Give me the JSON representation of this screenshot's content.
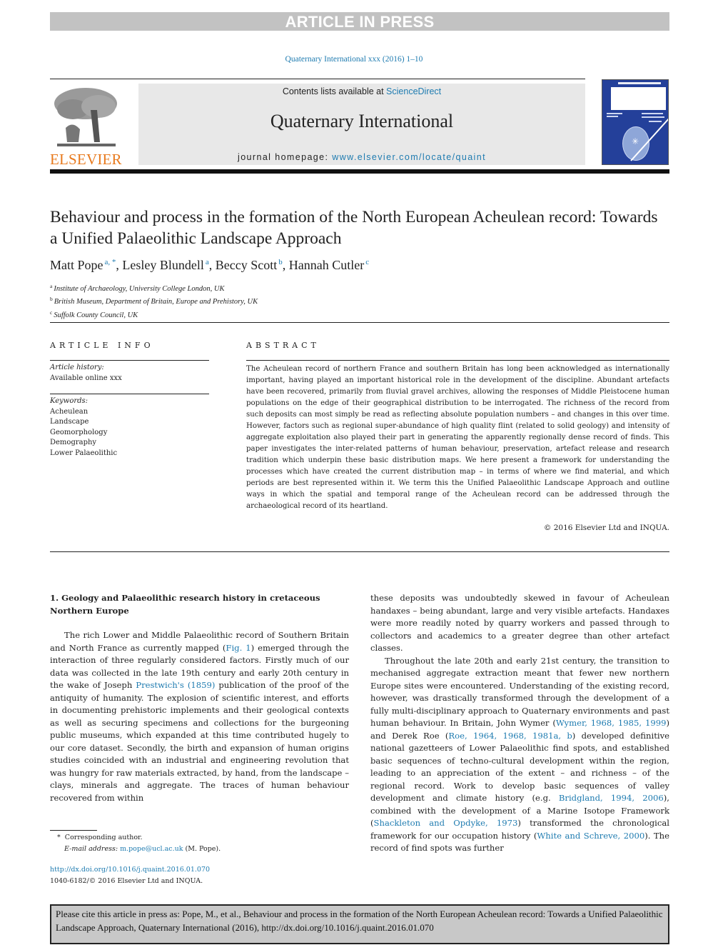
{
  "banner": "ARTICLE IN PRESS",
  "journal_ref": "Quaternary International xxx (2016) 1–10",
  "header": {
    "contents_prefix": "Contents lists available at ",
    "contents_link": "ScienceDirect",
    "journal_name": "Quaternary International",
    "homepage_prefix": "journal homepage: ",
    "homepage_link": "www.elsevier.com/locate/quaint",
    "publisher_logo": "ELSEVIER"
  },
  "article": {
    "title": "Behaviour and process in the formation of the North European Acheulean record: Towards a Unified Palaeolithic Landscape Approach",
    "authors": [
      {
        "name": "Matt Pope",
        "sup": "a, *",
        "sep": ", "
      },
      {
        "name": "Lesley Blundell",
        "sup": "a",
        "sep": ", "
      },
      {
        "name": "Beccy Scott",
        "sup": "b",
        "sep": ", "
      },
      {
        "name": "Hannah Cutler",
        "sup": "c",
        "sep": ""
      }
    ],
    "affiliations": [
      {
        "mark": "a",
        "text": "Institute of Archaeology, University College London, UK"
      },
      {
        "mark": "b",
        "text": "British Museum, Department of Britain, Europe and Prehistory, UK"
      },
      {
        "mark": "c",
        "text": "Suffolk County Council, UK"
      }
    ]
  },
  "article_info": {
    "heading": "ARTICLE INFO",
    "history_label": "Article history:",
    "history_value": "Available online xxx",
    "keywords_label": "Keywords:",
    "keywords": [
      "Acheulean",
      "Landscape",
      "Geomorphology",
      "Demography",
      "Lower Palaeolithic"
    ]
  },
  "abstract": {
    "heading": "ABSTRACT",
    "text": "The Acheulean record of northern France and southern Britain has long been acknowledged as internationally important, having played an important historical role in the development of the discipline. Abundant artefacts have been recovered, primarily from fluvial gravel archives, allowing the responses of Middle Pleistocene human populations on the edge of their geographical distribution to be interrogated. The richness of the record from such deposits can most simply be read as reflecting absolute population numbers – and changes in this over time. However, factors such as regional super-abundance of high quality flint (related to solid geology) and intensity of aggregate exploitation also played their part in generating the apparently regionally dense record of finds. This paper investigates the inter-related patterns of human behaviour, preservation, artefact release and research tradition which underpin these basic distribution maps. We here present a framework for understanding the processes which have created the current distribution map – in terms of where we find material, and which periods are best represented within it. We term this the Unified Palaeolithic Landscape Approach and outline ways in which the spatial and temporal range of the Acheulean record can be addressed through the archaeological record of its heartland.",
    "copyright": "© 2016 Elsevier Ltd and INQUA."
  },
  "body": {
    "section_heading": "1.  Geology and Palaeolithic research history in cretaceous Northern Europe",
    "p1": {
      "t1": "The rich Lower and Middle Palaeolithic record of Southern Britain and North France as currently mapped (",
      "l1": "Fig. 1",
      "t2": ") emerged through the interaction of three regularly considered factors. Firstly much of our data was collected in the late 19th century and early 20th century in the wake of Joseph ",
      "l2": "Prestwich's (1859)",
      "t3": " publication of the proof of the antiquity of humanity. The explosion of scientific interest, and efforts in documenting prehistoric implements and their geological contexts as well as securing specimens and collections for the burgeoning public museums, which expanded at this time contributed hugely to our core dataset. Secondly, the birth and expansion of human origins studies coincided with an industrial and engineering revolution that was hungry for raw materials extracted, by hand, from the landscape – clays, minerals and aggregate. The traces of human behaviour recovered from within"
    },
    "p1_cont": "these deposits was undoubtedly skewed in favour of Acheulean handaxes – being abundant, large and very visible artefacts. Handaxes were more readily noted by quarry workers and passed through to collectors and academics to a greater degree than other artefact classes.",
    "p2": {
      "t1": "Throughout the late 20th and early 21st century, the transition to mechanised aggregate extraction meant that fewer new northern Europe sites were encountered. Understanding of the existing record, however, was drastically transformed through the development of a fully multi-disciplinary approach to Quaternary environments and past human behaviour. In Britain, John Wymer (",
      "l1": "Wymer, 1968, 1985, 1999",
      "t2": ") and Derek Roe (",
      "l2": "Roe, 1964, 1968, 1981a, b",
      "t3": ") developed definitive national gazetteers of Lower Palaeolithic find spots, and established basic sequences of techno-cultural development within the region, leading to an appreciation of the extent – and richness – of the regional record. Work to develop basic sequences of valley development and climate history (e.g. ",
      "l3": "Bridgland, 1994, 2006",
      "t4": "), combined with the development of a Marine Isotope Framework (",
      "l4": "Shackleton and Opdyke, 1973",
      "t5": ") transformed the chronological framework for our occupation history (",
      "l5": "White and Schreve, 2000",
      "t6": "). The record of find spots was further"
    }
  },
  "footnote": {
    "star": "*",
    "corresponding": "Corresponding author.",
    "email_label": "E-mail address:",
    "email": "m.pope@ucl.ac.uk",
    "email_suffix": " (M. Pope)."
  },
  "doi": {
    "link": "http://dx.doi.org/10.1016/j.quaint.2016.01.070",
    "issn_line": "1040-6182/© 2016 Elsevier Ltd and INQUA."
  },
  "citation_box": "Please cite this article in press as: Pope, M., et al., Behaviour and process in the formation of the North European Acheulean record: Towards a Unified Palaeolithic Landscape Approach, Quaternary International (2016), http://dx.doi.org/10.1016/j.quaint.2016.01.070"
}
